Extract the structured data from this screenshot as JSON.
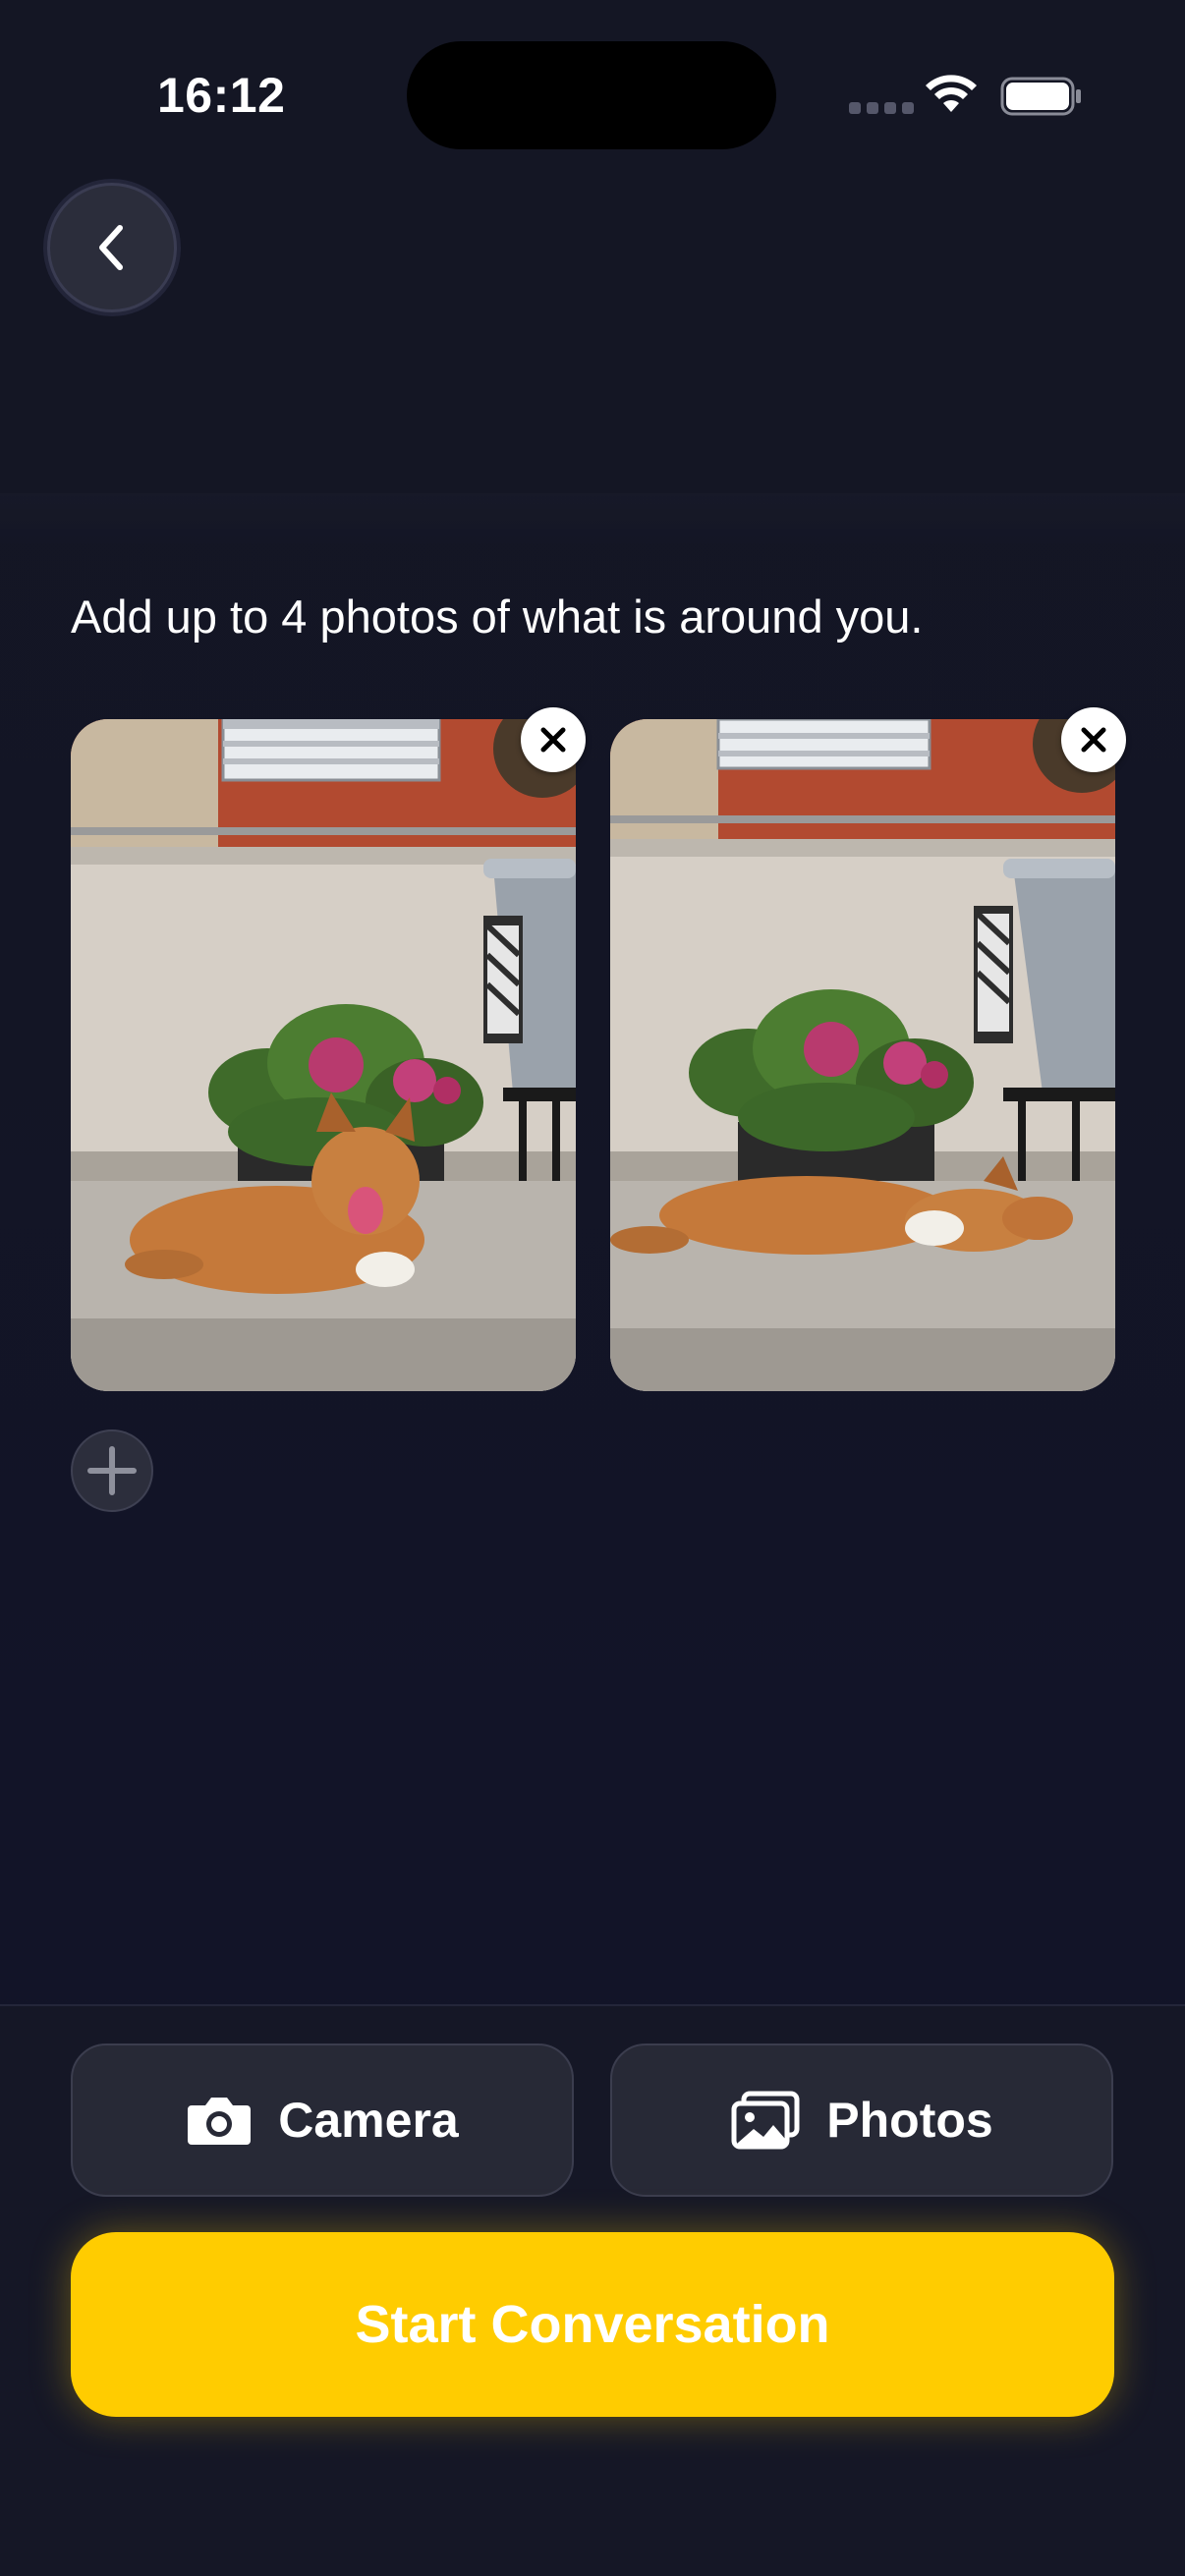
{
  "status_bar": {
    "time": "16:12"
  },
  "icons": {
    "back": "chevron-left-icon",
    "remove": "close-icon",
    "add": "plus-icon",
    "camera": "camera-icon",
    "photos": "photos-icon"
  },
  "main": {
    "instruction": "Add up to 4 photos of what is around you.",
    "photos": [
      {
        "description_icon": "photo-dog-sitting"
      },
      {
        "description_icon": "photo-dog-lying"
      }
    ]
  },
  "actions": {
    "camera_label": "Camera",
    "photos_label": "Photos",
    "start_label": "Start Conversation"
  },
  "colors": {
    "accent": "#ffcc00",
    "background": "#131525",
    "button_bg": "#272936"
  }
}
